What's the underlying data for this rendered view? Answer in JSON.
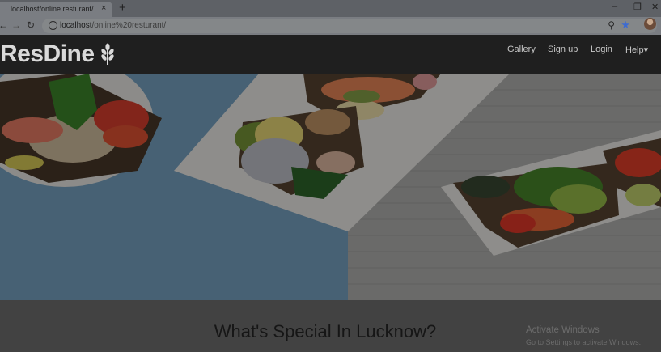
{
  "browser": {
    "tab_title": "localhost/online resturant/",
    "tab_close": "×",
    "new_tab": "+",
    "minimize": "–",
    "restore": "❐",
    "close": "✕",
    "back": "←",
    "forward": "→",
    "reload": "↻",
    "url_host": "localhost",
    "url_path": "/online%20resturant/",
    "star_color": "#3d6bd1"
  },
  "navbar": {
    "brand": "ResDine",
    "links": [
      "Gallery",
      "Sign up",
      "Login",
      "Help"
    ],
    "help_caret": "▾"
  },
  "hero": {
    "image": "open-faced sandwiches on white plates"
  },
  "section": {
    "title": "What's Special In Lucknow?"
  },
  "watermark": {
    "title": "Activate Windows",
    "subtitle": "Go to Settings to activate Windows."
  }
}
